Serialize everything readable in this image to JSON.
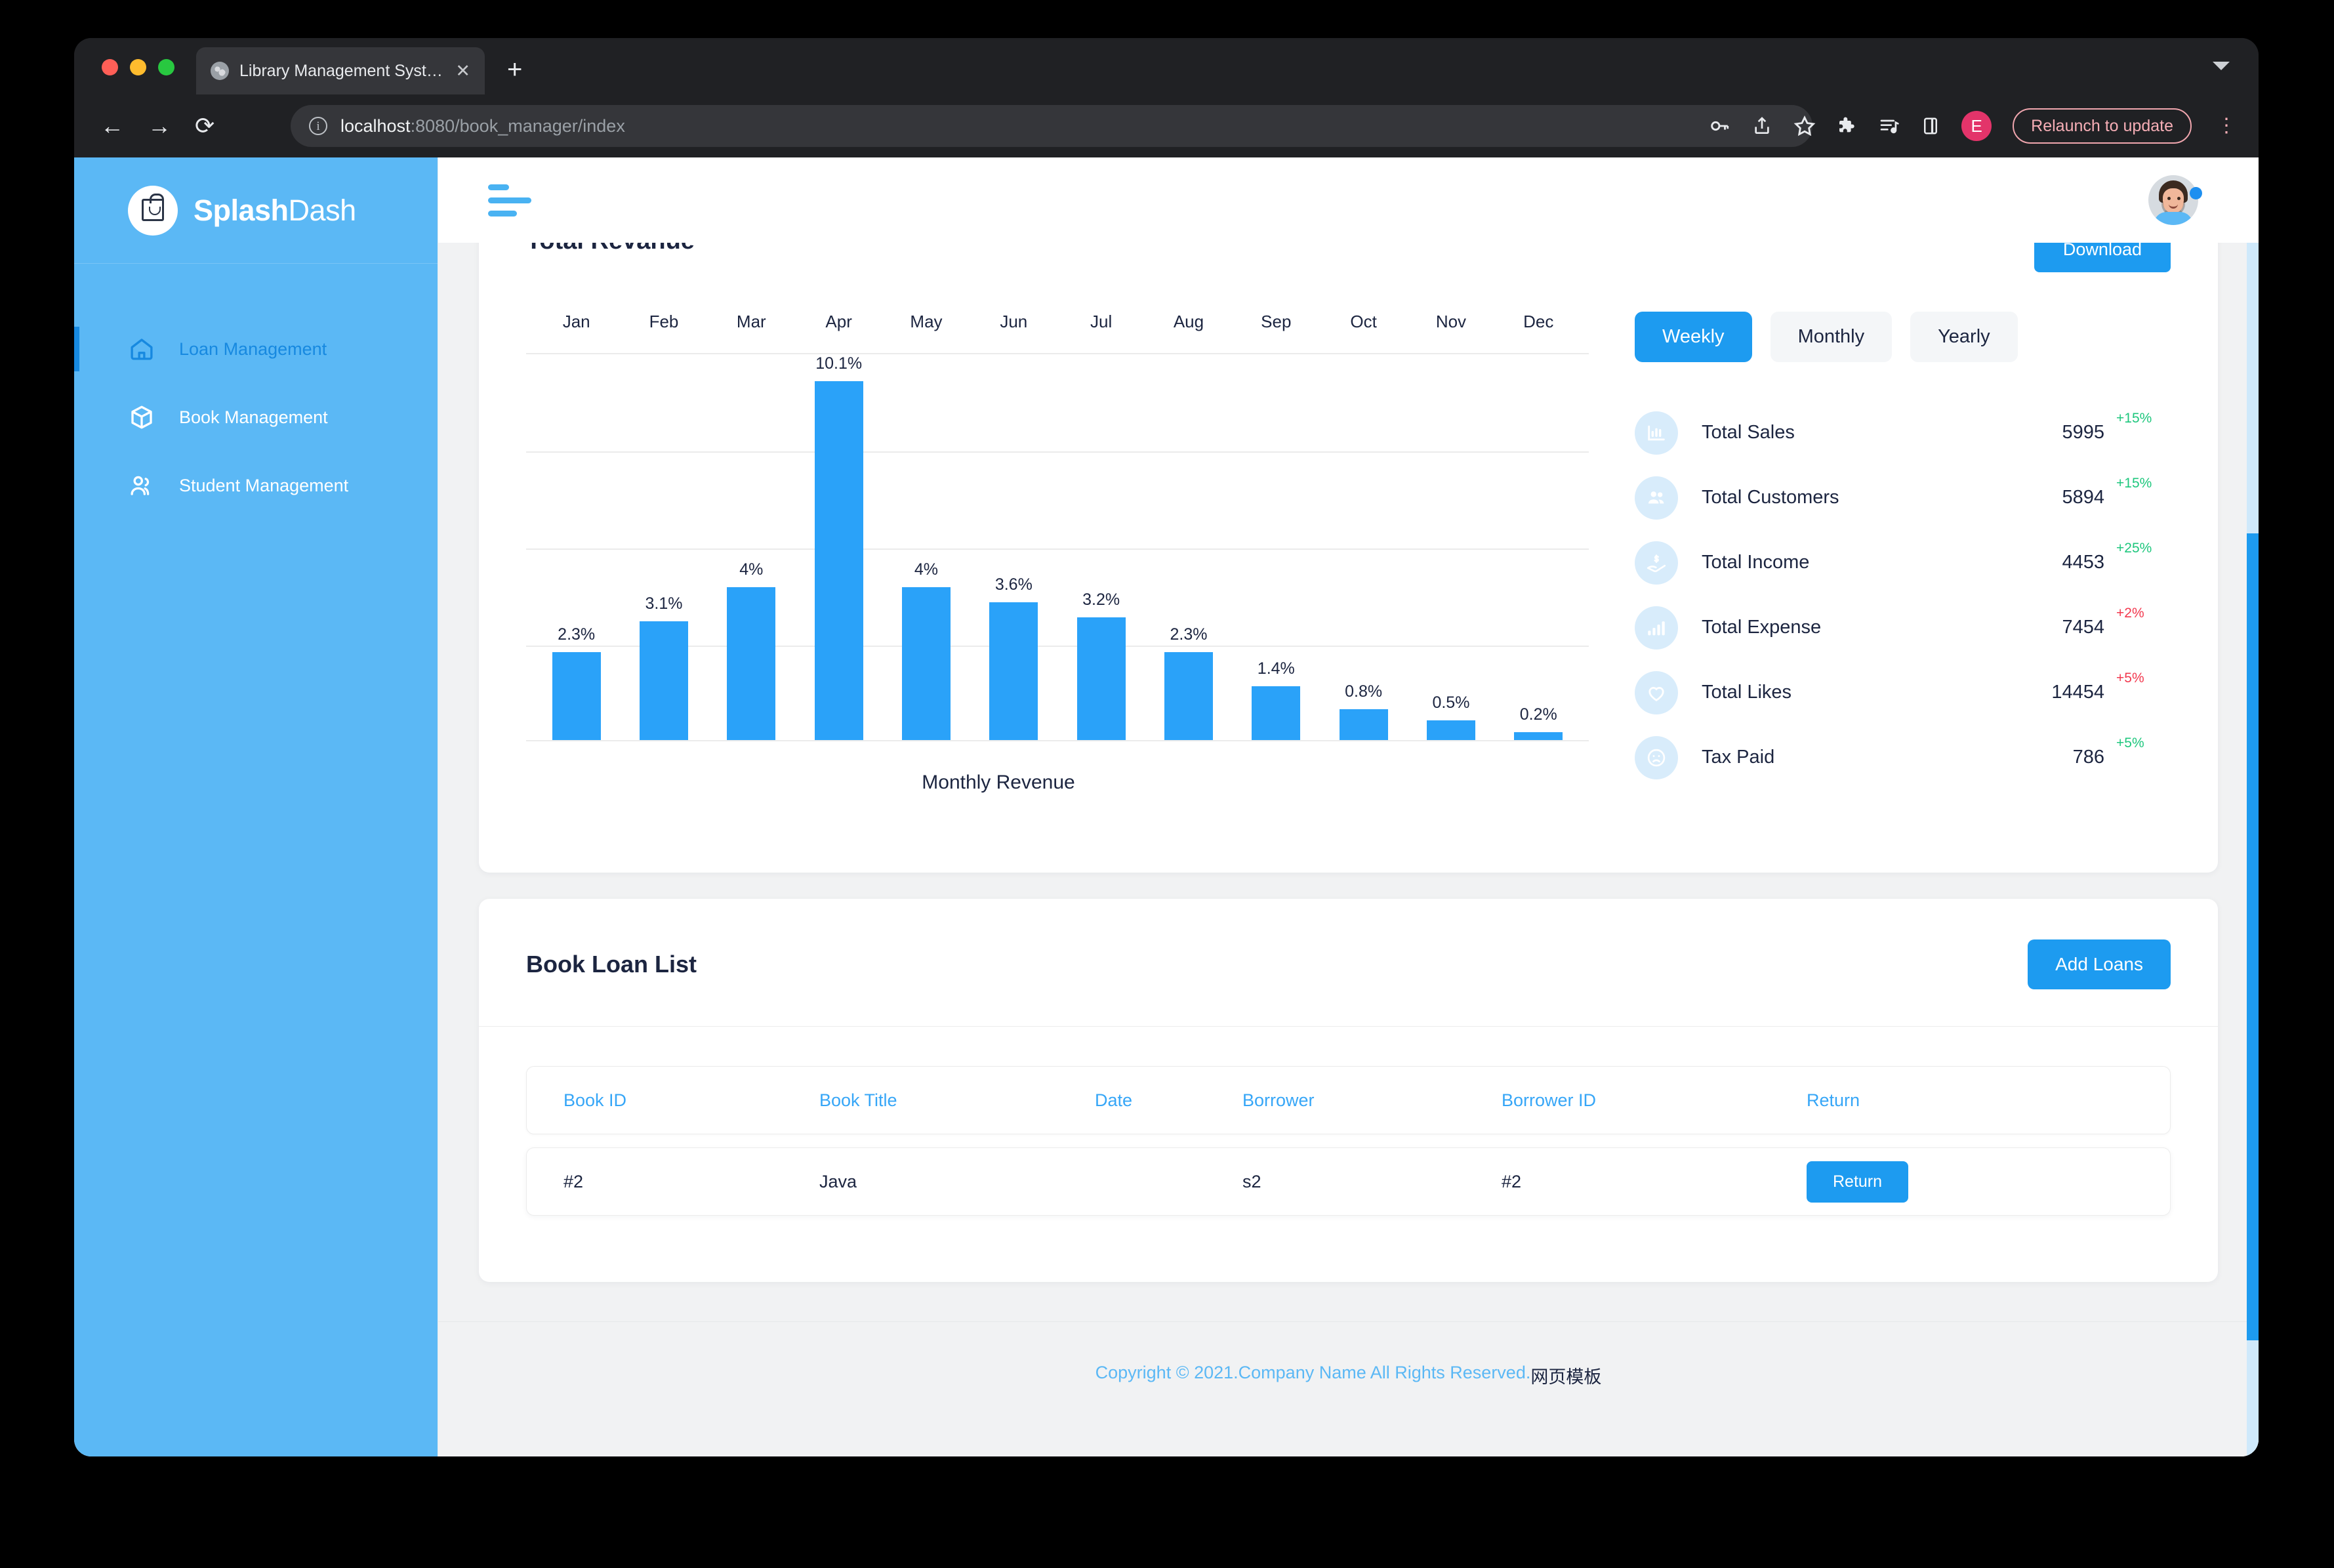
{
  "browser": {
    "tab_title": "Library Management System",
    "tab_close": "✕",
    "new_tab": "+",
    "back": "←",
    "forward": "→",
    "reload": "⟳",
    "url_host": "localhost",
    "url_path": ":8080/book_manager/index",
    "relaunch_label": "Relaunch to update",
    "profile_initial": "E",
    "kebab": "⋮"
  },
  "sidebar": {
    "brand_bold": "Splash",
    "brand_light": "Dash",
    "items": [
      {
        "label": "Loan Management",
        "icon": "home-icon",
        "active": true
      },
      {
        "label": "Book Management",
        "icon": "box-icon",
        "active": false
      },
      {
        "label": "Student Management",
        "icon": "users-icon",
        "active": false
      }
    ]
  },
  "revenue_card": {
    "title": "Total Revanue",
    "download_label": "Download",
    "segments": [
      {
        "label": "Weekly",
        "selected": true
      },
      {
        "label": "Monthly",
        "selected": false
      },
      {
        "label": "Yearly",
        "selected": false
      }
    ],
    "stats": [
      {
        "name": "Total Sales",
        "icon": "bar-chart-icon",
        "value": "5995",
        "delta": "+15%",
        "direction": "up"
      },
      {
        "name": "Total Customers",
        "icon": "users-group-icon",
        "value": "5894",
        "delta": "+15%",
        "direction": "up"
      },
      {
        "name": "Total Income",
        "icon": "hand-dollar-icon",
        "value": "4453",
        "delta": "+25%",
        "direction": "up"
      },
      {
        "name": "Total Expense",
        "icon": "signal-bars-icon",
        "value": "7454",
        "delta": "+2%",
        "direction": "down"
      },
      {
        "name": "Total Likes",
        "icon": "heart-icon",
        "value": "14454",
        "delta": "+5%",
        "direction": "down"
      },
      {
        "name": "Tax Paid",
        "icon": "sad-face-icon",
        "value": "786",
        "delta": "+5%",
        "direction": "up"
      }
    ]
  },
  "chart_data": {
    "type": "bar",
    "title": "Total Revanue",
    "xlabel": "Monthly Revenue",
    "ylabel": "",
    "categories": [
      "Jan",
      "Feb",
      "Mar",
      "Apr",
      "May",
      "Jun",
      "Jul",
      "Aug",
      "Sep",
      "Oct",
      "Nov",
      "Dec"
    ],
    "values": [
      2.3,
      3.1,
      4,
      10.1,
      4,
      3.6,
      3.2,
      2.3,
      1.4,
      0.8,
      0.5,
      0.2
    ],
    "value_labels": [
      "2.3%",
      "3.1%",
      "4%",
      "10.1%",
      "4%",
      "3.6%",
      "3.2%",
      "2.3%",
      "1.4%",
      "0.8%",
      "0.5%",
      "0.2%"
    ],
    "ylim": [
      0,
      12
    ],
    "grid": true,
    "legend": "none",
    "bar_color": "#2aa2f9",
    "tick_position": "top"
  },
  "loan_card": {
    "title": "Book Loan List",
    "add_label": "Add Loans",
    "columns": [
      "Book ID",
      "Book Title",
      "Date",
      "Borrower",
      "Borrower ID",
      "Return"
    ],
    "rows": [
      {
        "book_id": "#2",
        "book_title": "Java",
        "date": "",
        "borrower": "s2",
        "borrower_id": "#2",
        "action_label": "Return"
      }
    ]
  },
  "footer": {
    "copyright": "Copyright © 2021.Company Name All Rights Reserved.",
    "template_cn": "网页模板"
  }
}
